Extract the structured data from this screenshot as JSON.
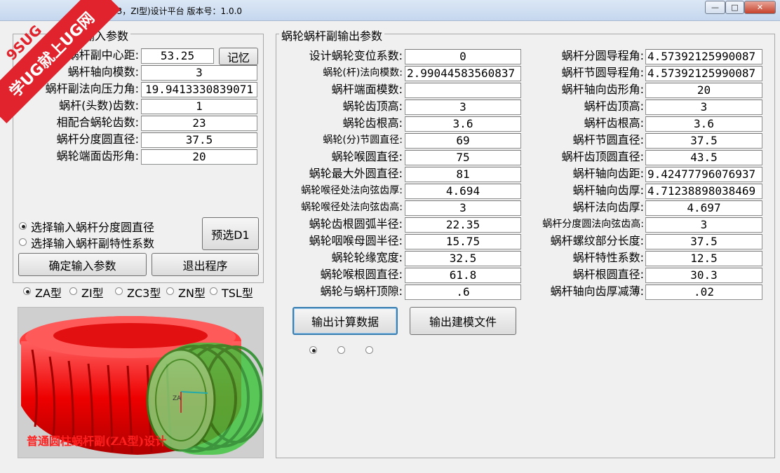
{
  "window": {
    "title": "ZC3，ZI型)设计平台 版本号：1.0.0",
    "minimize_glyph": "—",
    "maximize_glyph": "□",
    "close_glyph": "✕"
  },
  "watermark": {
    "line1": "9SUG",
    "line2": "学UG就上UG网"
  },
  "input_group": {
    "title": "副输入参数",
    "rows": [
      {
        "label": "蜗杆副中心距:",
        "value": "53.25"
      },
      {
        "label": "蜗杆轴向模数:",
        "value": "3"
      },
      {
        "label": "蜗杆副法向压力角:",
        "value": "19.9413330839071"
      },
      {
        "label": "蜗杆(头数)齿数:",
        "value": "1"
      },
      {
        "label": "相配合蜗轮齿数:",
        "value": "23"
      },
      {
        "label": "蜗杆分度圆直径:",
        "value": "37.5"
      },
      {
        "label": "蜗轮端面齿形角:",
        "value": "20"
      }
    ],
    "memory_button": "记忆",
    "radio_options": [
      "选择输入蜗杆分度圆直径",
      "选择输入蜗杆副特性系数"
    ],
    "radio_selected": 0,
    "preselect_button": "预选D1",
    "confirm_button": "确定输入参数",
    "exit_button": "退出程序"
  },
  "type_options": {
    "items": [
      "ZA型",
      "ZI型",
      "ZC3型",
      "ZN型",
      "TSL型"
    ],
    "selected": 0
  },
  "preview": {
    "caption": "普通圆柱蜗杆副(ZA型)设计",
    "axis_label": "ZA"
  },
  "output_group": {
    "title": "蜗轮蜗杆副输出参数",
    "left_rows": [
      {
        "label": "设计蜗轮变位系数:",
        "value": "0"
      },
      {
        "label": "蜗轮(杆)法向模数:",
        "value": "2.99044583560837"
      },
      {
        "label": "蜗杆端面模数:",
        "value": ""
      },
      {
        "label": "蜗轮齿顶高:",
        "value": "3"
      },
      {
        "label": "蜗轮齿根高:",
        "value": "3.6"
      },
      {
        "label": "蜗轮(分)节圆直径:",
        "value": "69"
      },
      {
        "label": "蜗轮喉圆直径:",
        "value": "75"
      },
      {
        "label": "蜗轮最大外圆直径:",
        "value": "81"
      },
      {
        "label": "蜗轮喉径处法向弦齿厚:",
        "value": "4.694"
      },
      {
        "label": "蜗轮喉径处法向弦齿高:",
        "value": "3"
      },
      {
        "label": "蜗轮齿根圆弧半径:",
        "value": "22.35"
      },
      {
        "label": "蜗轮咽喉母圆半径:",
        "value": "15.75"
      },
      {
        "label": "蜗轮轮缘宽度:",
        "value": "32.5"
      },
      {
        "label": "蜗轮喉根圆直径:",
        "value": "61.8"
      },
      {
        "label": "蜗轮与蜗杆顶隙:",
        "value": ".6"
      }
    ],
    "right_rows": [
      {
        "label": "蜗杆分圆导程角:",
        "value": "4.57392125990087"
      },
      {
        "label": "蜗杆节圆导程角:",
        "value": "4.57392125990087"
      },
      {
        "label": "蜗杆轴向齿形角:",
        "value": "20"
      },
      {
        "label": "蜗杆齿顶高:",
        "value": "3"
      },
      {
        "label": "蜗杆齿根高:",
        "value": "3.6"
      },
      {
        "label": "蜗杆节圆直径:",
        "value": "37.5"
      },
      {
        "label": "蜗杆齿顶圆直径:",
        "value": "43.5"
      },
      {
        "label": "蜗杆轴向齿距:",
        "value": "9.42477796076937"
      },
      {
        "label": "蜗杆轴向齿厚:",
        "value": "4.71238898038469"
      },
      {
        "label": "蜗杆法向齿厚:",
        "value": "4.697"
      },
      {
        "label": "蜗杆分度圆法向弦齿高:",
        "value": "3"
      },
      {
        "label": "蜗杆螺纹部分长度:",
        "value": "37.5"
      },
      {
        "label": "蜗杆特性系数:",
        "value": "12.5"
      },
      {
        "label": "蜗杆根圆直径:",
        "value": "30.3"
      },
      {
        "label": "蜗杆轴向齿厚减薄:",
        "value": ".02"
      }
    ],
    "output_calc_button": "输出计算数据",
    "output_model_button": "输出建模文件",
    "small_radio_selected": 0
  }
}
